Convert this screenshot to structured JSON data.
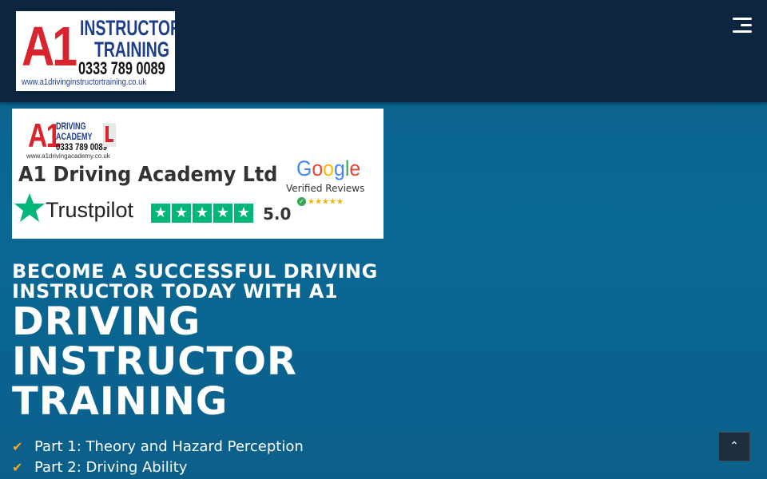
{
  "header": {
    "logo": {
      "mark": "A1",
      "line1": "INSTRUCTOR",
      "line2": "TRAINING",
      "phone": "0333 789 0089",
      "url": "www.a1drivinginstructortraining.co.uk",
      "colors": {
        "red": "#d9232d",
        "blue": "#1d3e8c"
      }
    },
    "menu_icon": "hamburger-menu-icon",
    "background": "#0c2640"
  },
  "banner": {
    "academy_logo": {
      "mark": "A1",
      "line1": "DRIVING",
      "line2": "ACADEMY",
      "phone": "0333 789 0089",
      "url": "www.a1drivingacademy.co.uk"
    },
    "company_name": "A1 Driving Academy Ltd",
    "google": {
      "word": "Google",
      "caption": "Verified Reviews",
      "stars": "★★★★★"
    },
    "trustpilot": {
      "word": "Trustpilot",
      "stars": "★★★★★",
      "score": "5.0",
      "color": "#00b67a"
    }
  },
  "hero": {
    "subheading": "BECOME A SUCCESSFUL DRIVING INSTRUCTOR TODAY WITH A1",
    "headline": "DRIVING INSTRUCTOR TRAINING",
    "features": [
      {
        "icon": "check-icon",
        "label": "Part 1: Theory and Hazard Perception"
      },
      {
        "icon": "check-icon",
        "label": "Part 2: Driving Ability"
      }
    ],
    "check_color": "#f0a929"
  },
  "scroll_top": {
    "icon": "double-chevron-up-icon",
    "glyph": "⌃"
  }
}
